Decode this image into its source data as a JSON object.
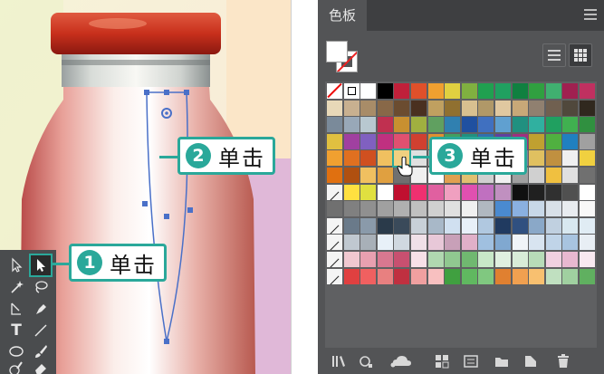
{
  "callouts": [
    {
      "num": "1",
      "text": "单击"
    },
    {
      "num": "2",
      "text": "单击"
    },
    {
      "num": "3",
      "text": "单击"
    }
  ],
  "toolbar": {
    "tools": [
      {
        "name": "direct-selection-tool",
        "icon": "hollow-arrow-icon"
      },
      {
        "name": "selection-tool",
        "icon": "solid-arrow-icon",
        "active": true
      },
      {
        "name": "magic-wand-tool",
        "icon": "magic-wand-icon"
      },
      {
        "name": "lasso-tool",
        "icon": "lasso-icon"
      },
      {
        "name": "pen-anchor-tool",
        "icon": "anchor-icon"
      },
      {
        "name": "pen-tool",
        "icon": "pen-icon"
      },
      {
        "name": "type-tool",
        "icon": "type-icon",
        "glyph": "T"
      },
      {
        "name": "line-tool",
        "icon": "line-icon"
      },
      {
        "name": "ellipse-tool",
        "icon": "ellipse-icon"
      },
      {
        "name": "brush-tool",
        "icon": "brush-icon"
      },
      {
        "name": "blob-brush-tool",
        "icon": "blob-brush-icon"
      },
      {
        "name": "eraser-tool",
        "icon": "eraser-icon"
      }
    ]
  },
  "panel": {
    "tab_label": "色板",
    "menu_icon": "hamburger-icon",
    "fill_color": "#ffffff",
    "stroke": "none",
    "view_modes": [
      "list-view-icon",
      "grid-view-icon"
    ],
    "active_view": "grid",
    "bottom_icons": [
      "swatch-library-icon",
      "show-kinds-icon",
      "cc-library-icon",
      "swatch-options-icon",
      "color-group-icon",
      "new-folder-icon",
      "new-swatch-icon",
      "trash-icon"
    ]
  },
  "swatch_rows": [
    [
      "none",
      "registration",
      "#ffffff",
      "#000000",
      "#c0203a",
      "#e0502a",
      "#f0a030",
      "#e0d040",
      "#80b040",
      "#20a050",
      "#20a060",
      "#108040",
      "#30a040",
      "#40b070",
      "#a02050",
      "#c03060"
    ],
    [
      "#e8d8b8",
      "#c8b090",
      "#a88c68",
      "#886848",
      "#6b4c30",
      "#4a3020",
      "#c0a060",
      "#907030",
      "#d8c090",
      "#b09868",
      "#e0c8a0",
      "#c8a878",
      "#908070",
      "#706050",
      "#50483c",
      "#30281e"
    ],
    [
      "#7a8a9a",
      "#98a8b8",
      "#b8c8d0",
      "#c03050",
      "#c89030",
      "#a0b040",
      "#60a060",
      "#3080b0",
      "#2050a0",
      "#4070c0",
      "#60a0d0",
      "#209080",
      "#30b0a0",
      "#20a060",
      "#40b050",
      "#309040"
    ],
    [
      "#e0c040",
      "#a040a0",
      "#8060c0",
      "#c03080",
      "#e05070",
      "#d04030",
      "#e09030",
      "#40a060",
      "#209080",
      "#3070b0",
      "#6040a0",
      "#a03080",
      "#c0a030",
      "#50b040",
      "#2080c0",
      "#a0a0a0"
    ],
    [
      "#f0a030",
      "#e07020",
      "#d05020",
      "#f0c060",
      "#f0d080",
      "#e0e0e0",
      "#b0b0b0",
      "#909090",
      "#e0b030",
      "#5060a0",
      "#c0c0c0",
      "#8080a0",
      "#e0c060",
      "#c09040",
      "#f0f0f0",
      "#f0d040"
    ],
    [
      "#e07010",
      "#b05010",
      "#f0c060",
      "#e0a040",
      "#707070",
      "#f0f0f0",
      "#ffffff",
      "#e0a050",
      "#e0c070",
      "#d0d0d0",
      "#f0f0f0",
      "#a0a0a0",
      "#d0d0d0",
      "#f0c040",
      "#e0e0e0",
      "#707070"
    ],
    [
      "folder",
      "#ffe040",
      "#e0e040",
      "#ffffff",
      "#c01030",
      "#f03070",
      "#e060a0",
      "#f0a0c0",
      "#e050b0",
      "#c070c0",
      "#c090c0",
      "#101010",
      "#202020",
      "#303030",
      "#505050",
      "#ffffff"
    ],
    [
      "#707070",
      "#808080",
      "#909090",
      "#a0a0a0",
      "#b0b0b0",
      "#c0c0c0",
      "#d0d0d0",
      "#e0e0e0",
      "#f0f0f0",
      "#b0b8c0",
      "#4a8ad0",
      "#8ab0e0",
      "#c8d8e8",
      "#d8e0e8",
      "#e8ecf0",
      "#f8f8f8"
    ],
    [
      "folder",
      "#6a7a8a",
      "#8a9aaa",
      "#2a3a4a",
      "#3a4a5a",
      "#c8d0d8",
      "#a8b8c8",
      "#d0e0f0",
      "#e8f0f8",
      "#b0c8e0",
      "#203a60",
      "#305080",
      "#8aa8c8",
      "#c0d0e0",
      "#d8e8f0",
      "#e0ecf4"
    ],
    [
      "folder",
      "#c0c8d0",
      "#a8b0b8",
      "#e8f0f8",
      "#d0d8e0",
      "#f0e0e8",
      "#e8c8d8",
      "#c8a0b8",
      "#e0b0c8",
      "#a0c0e0",
      "#80a8d0",
      "#f0f4f8",
      "#d8e4f0",
      "#c0d4e8",
      "#a8c4e0",
      "#e8eef4"
    ],
    [
      "folder",
      "#f0c8d0",
      "#e8a0b0",
      "#d87890",
      "#c85070",
      "#f8e0e8",
      "#b0d8b0",
      "#90c890",
      "#70b870",
      "#c8e8c8",
      "#e0f0e0",
      "#d8ecd8",
      "#b8dcb8",
      "#f0d0e0",
      "#e8b8d0",
      "#f8e8f0"
    ],
    [
      "folder",
      "#e04040",
      "#f06060",
      "#e88080",
      "#c03040",
      "#f0a0a0",
      "#f8c0c0",
      "#40a040",
      "#60b860",
      "#80c880",
      "#e08030",
      "#f0a050",
      "#f8c070",
      "#c0e0c0",
      "#a0d0a0",
      "#60b060"
    ]
  ]
}
